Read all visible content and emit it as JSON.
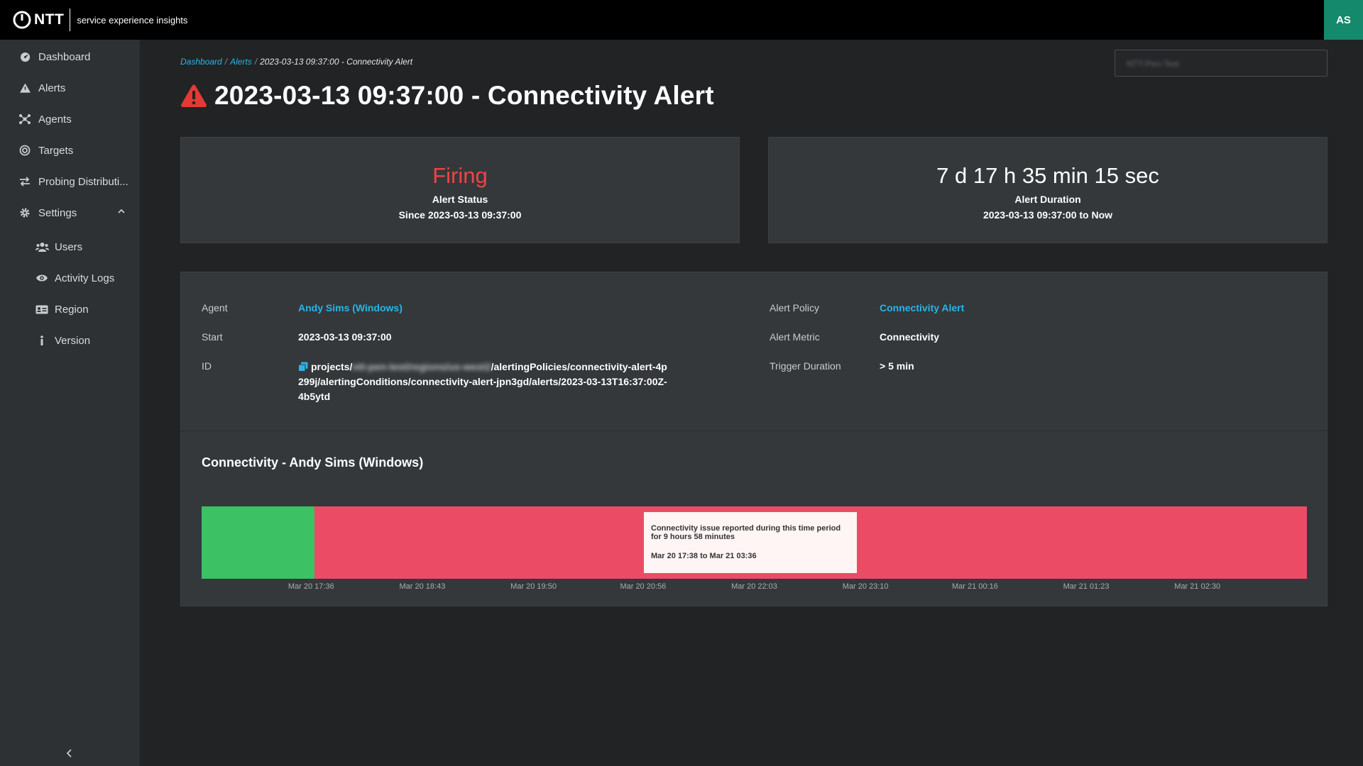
{
  "app": {
    "brand": "NTT",
    "subtitle": "service experience insights",
    "user_initials": "AS"
  },
  "sidebar": {
    "items": [
      {
        "label": "Dashboard",
        "icon": "dashboard-icon"
      },
      {
        "label": "Alerts",
        "icon": "alert-icon"
      },
      {
        "label": "Agents",
        "icon": "agents-icon"
      },
      {
        "label": "Targets",
        "icon": "target-icon"
      },
      {
        "label": "Probing Distributi...",
        "icon": "swap-icon"
      },
      {
        "label": "Settings",
        "icon": "gear-icon"
      }
    ],
    "settings_items": [
      {
        "label": "Users",
        "icon": "users-icon"
      },
      {
        "label": "Activity Logs",
        "icon": "eye-icon"
      },
      {
        "label": "Region",
        "icon": "region-icon"
      },
      {
        "label": "Version",
        "icon": "info-icon"
      }
    ]
  },
  "breadcrumb": {
    "home": "Dashboard",
    "alerts": "Alerts",
    "current": "2023-03-13 09:37:00 - Connectivity Alert",
    "sep": "/"
  },
  "search": {
    "value": "NTT-Pen-Test"
  },
  "page_title": "2023-03-13 09:37:00 - Connectivity Alert",
  "status_card": {
    "value": "Firing",
    "label": "Alert Status",
    "sub": "Since 2023-03-13 09:37:00",
    "color": "#ef4444"
  },
  "duration_card": {
    "value": "7 d 17 h 35 min 15 sec",
    "label": "Alert Duration",
    "sub": "2023-03-13 09:37:00 to Now"
  },
  "details": {
    "agent_label": "Agent",
    "agent_value": "Andy Sims (Windows)",
    "start_label": "Start",
    "start_value": "2023-03-13 09:37:00",
    "id_label": "ID",
    "id_prefix": "projects/",
    "id_blurred": "ntt-pen-test/regions/us-west2",
    "id_suffix": "/alertingPolicies/connectivity-alert-4p299j/alertingConditions/connectivity-alert-jpn3gd/alerts/2023-03-13T16:37:00Z-4b5ytd",
    "policy_label": "Alert Policy",
    "policy_value": "Connectivity Alert",
    "metric_label": "Alert Metric",
    "metric_value": "Connectivity",
    "trigger_label": "Trigger Duration",
    "trigger_value": "> 5 min"
  },
  "chart_title": "Connectivity - Andy Sims (Windows)",
  "chart_data": {
    "type": "timeline",
    "title": "Connectivity - Andy Sims (Windows)",
    "x_ticks": [
      "Mar 20 17:36",
      "Mar 20 18:43",
      "Mar 20 19:50",
      "Mar 20 20:56",
      "Mar 20 22:03",
      "Mar 20 23:10",
      "Mar 21 00:16",
      "Mar 21 01:23",
      "Mar 21 02:30"
    ],
    "segments": [
      {
        "status": "ok",
        "start": "Mar 20 16:30",
        "end": "Mar 20 17:38",
        "color": "#3cc264"
      },
      {
        "status": "issue",
        "start": "Mar 20 17:38",
        "end": "Mar 21 03:36",
        "color": "#ec4b66"
      }
    ],
    "tooltip": {
      "line1": "Connectivity issue reported during this time period for 9 hours 58 minutes",
      "line2": "Mar 20 17:38 to Mar 21 03:36"
    }
  }
}
